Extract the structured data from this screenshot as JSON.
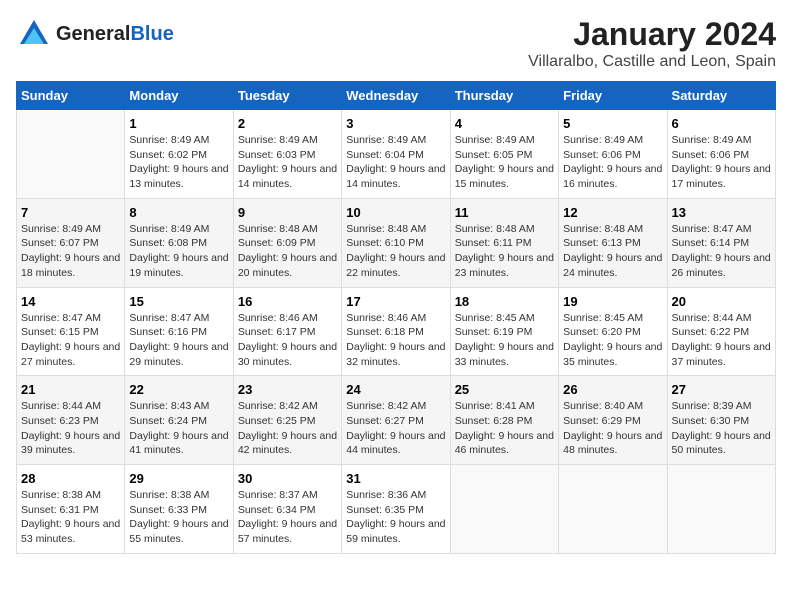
{
  "header": {
    "logo_general": "General",
    "logo_blue": "Blue",
    "title": "January 2024",
    "subtitle": "Villaralbo, Castille and Leon, Spain"
  },
  "days_of_week": [
    "Sunday",
    "Monday",
    "Tuesday",
    "Wednesday",
    "Thursday",
    "Friday",
    "Saturday"
  ],
  "weeks": [
    [
      {
        "day": "",
        "sunrise": "",
        "sunset": "",
        "daylight": ""
      },
      {
        "day": "1",
        "sunrise": "Sunrise: 8:49 AM",
        "sunset": "Sunset: 6:02 PM",
        "daylight": "Daylight: 9 hours and 13 minutes."
      },
      {
        "day": "2",
        "sunrise": "Sunrise: 8:49 AM",
        "sunset": "Sunset: 6:03 PM",
        "daylight": "Daylight: 9 hours and 14 minutes."
      },
      {
        "day": "3",
        "sunrise": "Sunrise: 8:49 AM",
        "sunset": "Sunset: 6:04 PM",
        "daylight": "Daylight: 9 hours and 14 minutes."
      },
      {
        "day": "4",
        "sunrise": "Sunrise: 8:49 AM",
        "sunset": "Sunset: 6:05 PM",
        "daylight": "Daylight: 9 hours and 15 minutes."
      },
      {
        "day": "5",
        "sunrise": "Sunrise: 8:49 AM",
        "sunset": "Sunset: 6:06 PM",
        "daylight": "Daylight: 9 hours and 16 minutes."
      },
      {
        "day": "6",
        "sunrise": "Sunrise: 8:49 AM",
        "sunset": "Sunset: 6:06 PM",
        "daylight": "Daylight: 9 hours and 17 minutes."
      }
    ],
    [
      {
        "day": "7",
        "sunrise": "Sunrise: 8:49 AM",
        "sunset": "Sunset: 6:07 PM",
        "daylight": "Daylight: 9 hours and 18 minutes."
      },
      {
        "day": "8",
        "sunrise": "Sunrise: 8:49 AM",
        "sunset": "Sunset: 6:08 PM",
        "daylight": "Daylight: 9 hours and 19 minutes."
      },
      {
        "day": "9",
        "sunrise": "Sunrise: 8:48 AM",
        "sunset": "Sunset: 6:09 PM",
        "daylight": "Daylight: 9 hours and 20 minutes."
      },
      {
        "day": "10",
        "sunrise": "Sunrise: 8:48 AM",
        "sunset": "Sunset: 6:10 PM",
        "daylight": "Daylight: 9 hours and 22 minutes."
      },
      {
        "day": "11",
        "sunrise": "Sunrise: 8:48 AM",
        "sunset": "Sunset: 6:11 PM",
        "daylight": "Daylight: 9 hours and 23 minutes."
      },
      {
        "day": "12",
        "sunrise": "Sunrise: 8:48 AM",
        "sunset": "Sunset: 6:13 PM",
        "daylight": "Daylight: 9 hours and 24 minutes."
      },
      {
        "day": "13",
        "sunrise": "Sunrise: 8:47 AM",
        "sunset": "Sunset: 6:14 PM",
        "daylight": "Daylight: 9 hours and 26 minutes."
      }
    ],
    [
      {
        "day": "14",
        "sunrise": "Sunrise: 8:47 AM",
        "sunset": "Sunset: 6:15 PM",
        "daylight": "Daylight: 9 hours and 27 minutes."
      },
      {
        "day": "15",
        "sunrise": "Sunrise: 8:47 AM",
        "sunset": "Sunset: 6:16 PM",
        "daylight": "Daylight: 9 hours and 29 minutes."
      },
      {
        "day": "16",
        "sunrise": "Sunrise: 8:46 AM",
        "sunset": "Sunset: 6:17 PM",
        "daylight": "Daylight: 9 hours and 30 minutes."
      },
      {
        "day": "17",
        "sunrise": "Sunrise: 8:46 AM",
        "sunset": "Sunset: 6:18 PM",
        "daylight": "Daylight: 9 hours and 32 minutes."
      },
      {
        "day": "18",
        "sunrise": "Sunrise: 8:45 AM",
        "sunset": "Sunset: 6:19 PM",
        "daylight": "Daylight: 9 hours and 33 minutes."
      },
      {
        "day": "19",
        "sunrise": "Sunrise: 8:45 AM",
        "sunset": "Sunset: 6:20 PM",
        "daylight": "Daylight: 9 hours and 35 minutes."
      },
      {
        "day": "20",
        "sunrise": "Sunrise: 8:44 AM",
        "sunset": "Sunset: 6:22 PM",
        "daylight": "Daylight: 9 hours and 37 minutes."
      }
    ],
    [
      {
        "day": "21",
        "sunrise": "Sunrise: 8:44 AM",
        "sunset": "Sunset: 6:23 PM",
        "daylight": "Daylight: 9 hours and 39 minutes."
      },
      {
        "day": "22",
        "sunrise": "Sunrise: 8:43 AM",
        "sunset": "Sunset: 6:24 PM",
        "daylight": "Daylight: 9 hours and 41 minutes."
      },
      {
        "day": "23",
        "sunrise": "Sunrise: 8:42 AM",
        "sunset": "Sunset: 6:25 PM",
        "daylight": "Daylight: 9 hours and 42 minutes."
      },
      {
        "day": "24",
        "sunrise": "Sunrise: 8:42 AM",
        "sunset": "Sunset: 6:27 PM",
        "daylight": "Daylight: 9 hours and 44 minutes."
      },
      {
        "day": "25",
        "sunrise": "Sunrise: 8:41 AM",
        "sunset": "Sunset: 6:28 PM",
        "daylight": "Daylight: 9 hours and 46 minutes."
      },
      {
        "day": "26",
        "sunrise": "Sunrise: 8:40 AM",
        "sunset": "Sunset: 6:29 PM",
        "daylight": "Daylight: 9 hours and 48 minutes."
      },
      {
        "day": "27",
        "sunrise": "Sunrise: 8:39 AM",
        "sunset": "Sunset: 6:30 PM",
        "daylight": "Daylight: 9 hours and 50 minutes."
      }
    ],
    [
      {
        "day": "28",
        "sunrise": "Sunrise: 8:38 AM",
        "sunset": "Sunset: 6:31 PM",
        "daylight": "Daylight: 9 hours and 53 minutes."
      },
      {
        "day": "29",
        "sunrise": "Sunrise: 8:38 AM",
        "sunset": "Sunset: 6:33 PM",
        "daylight": "Daylight: 9 hours and 55 minutes."
      },
      {
        "day": "30",
        "sunrise": "Sunrise: 8:37 AM",
        "sunset": "Sunset: 6:34 PM",
        "daylight": "Daylight: 9 hours and 57 minutes."
      },
      {
        "day": "31",
        "sunrise": "Sunrise: 8:36 AM",
        "sunset": "Sunset: 6:35 PM",
        "daylight": "Daylight: 9 hours and 59 minutes."
      },
      {
        "day": "",
        "sunrise": "",
        "sunset": "",
        "daylight": ""
      },
      {
        "day": "",
        "sunrise": "",
        "sunset": "",
        "daylight": ""
      },
      {
        "day": "",
        "sunrise": "",
        "sunset": "",
        "daylight": ""
      }
    ]
  ]
}
